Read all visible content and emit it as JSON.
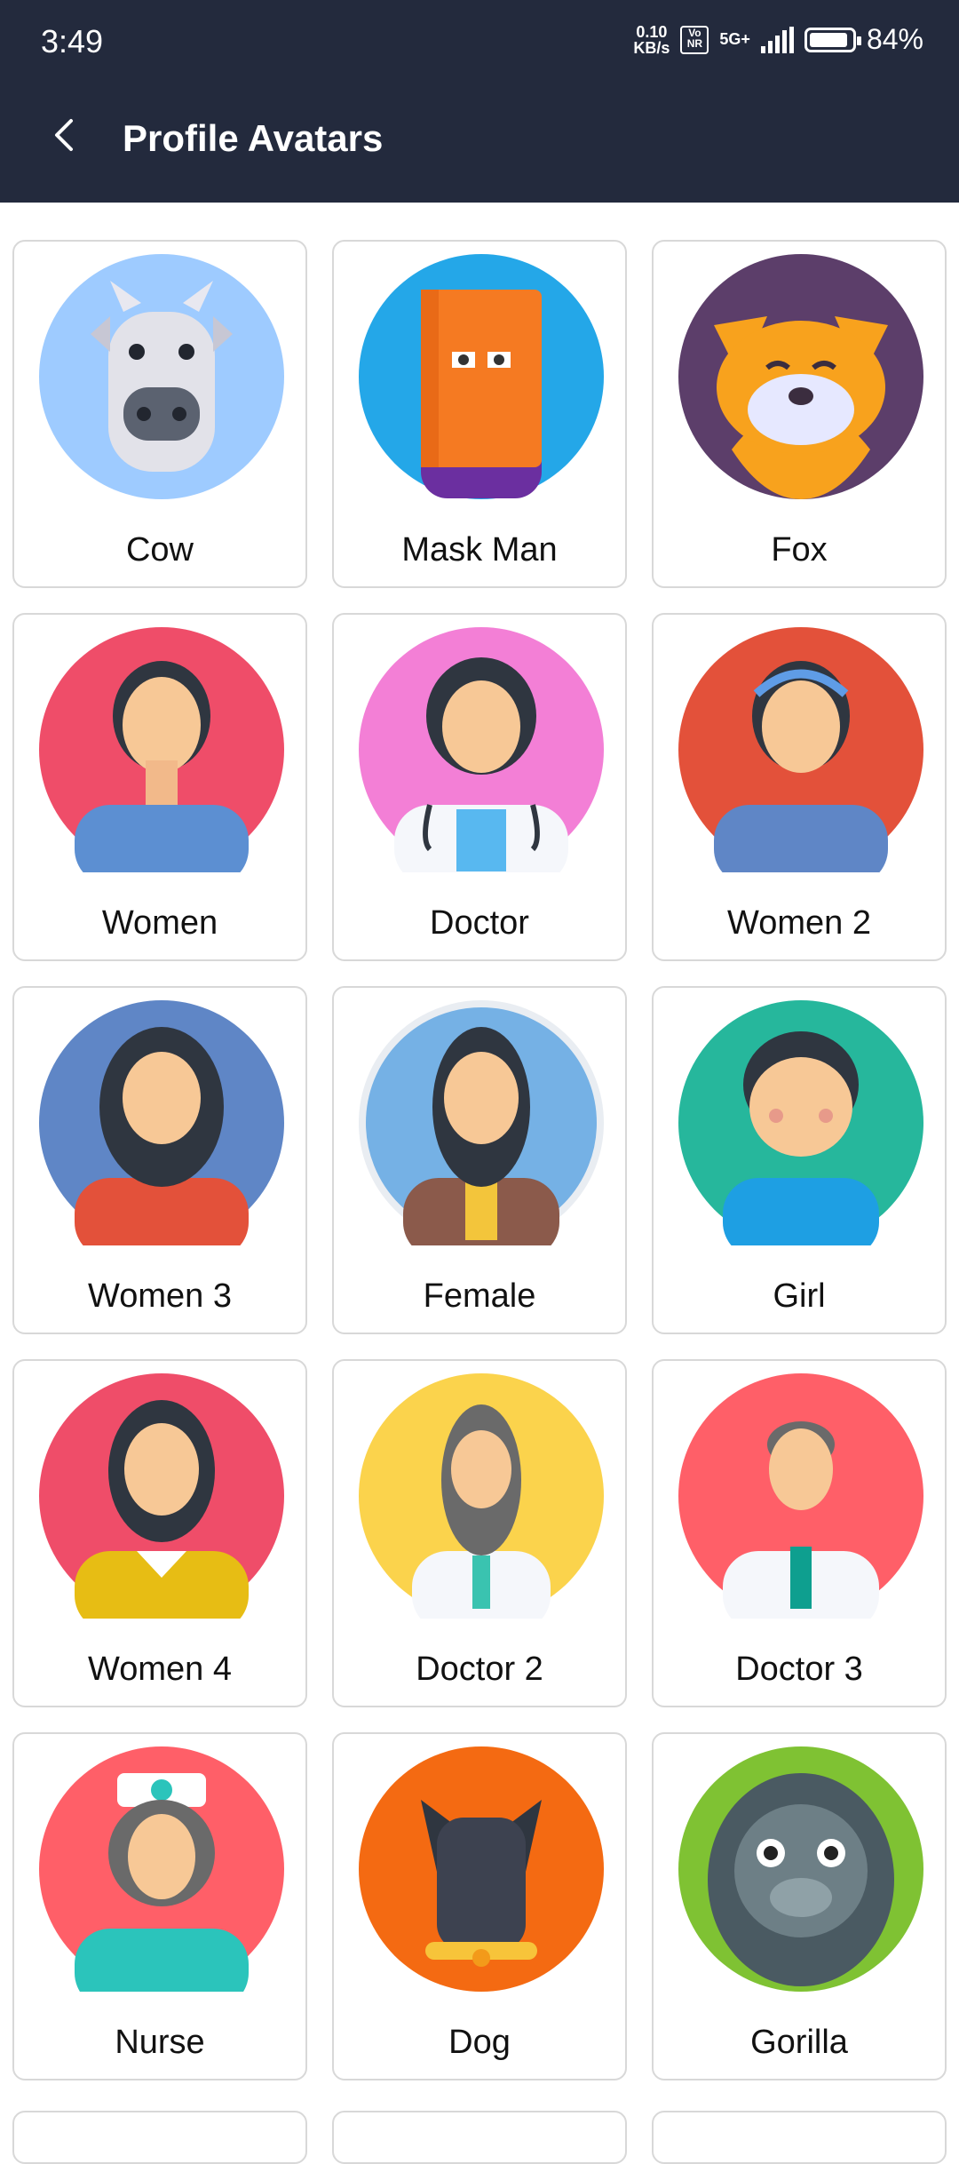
{
  "status": {
    "time": "3:49",
    "speed_value": "0.10",
    "speed_unit": "KB/s",
    "volte": "Vo NR",
    "network": "5G+",
    "battery": "84%"
  },
  "header": {
    "title": "Profile Avatars",
    "back_icon": "chevron-left-icon"
  },
  "avatars": [
    {
      "label": "Cow",
      "bg": "#9ecbff"
    },
    {
      "label": "Mask Man",
      "bg": "#24a7e8"
    },
    {
      "label": "Fox",
      "bg": "#5c3e6a"
    },
    {
      "label": "Women",
      "bg": "#ef4d69"
    },
    {
      "label": "Doctor",
      "bg": "#f37fd6"
    },
    {
      "label": "Women 2",
      "bg": "#e3513a"
    },
    {
      "label": "Women 3",
      "bg": "#5f86c6"
    },
    {
      "label": "Female",
      "bg": "#75b1e5"
    },
    {
      "label": "Girl",
      "bg": "#26b79c"
    },
    {
      "label": "Women 4",
      "bg": "#ef4d69"
    },
    {
      "label": "Doctor 2",
      "bg": "#fbd34c"
    },
    {
      "label": "Doctor 3",
      "bg": "#ff5f68"
    },
    {
      "label": "Nurse",
      "bg": "#ff5f68"
    },
    {
      "label": "Dog",
      "bg": "#f46a12"
    },
    {
      "label": "Gorilla",
      "bg": "#7fc233"
    }
  ]
}
